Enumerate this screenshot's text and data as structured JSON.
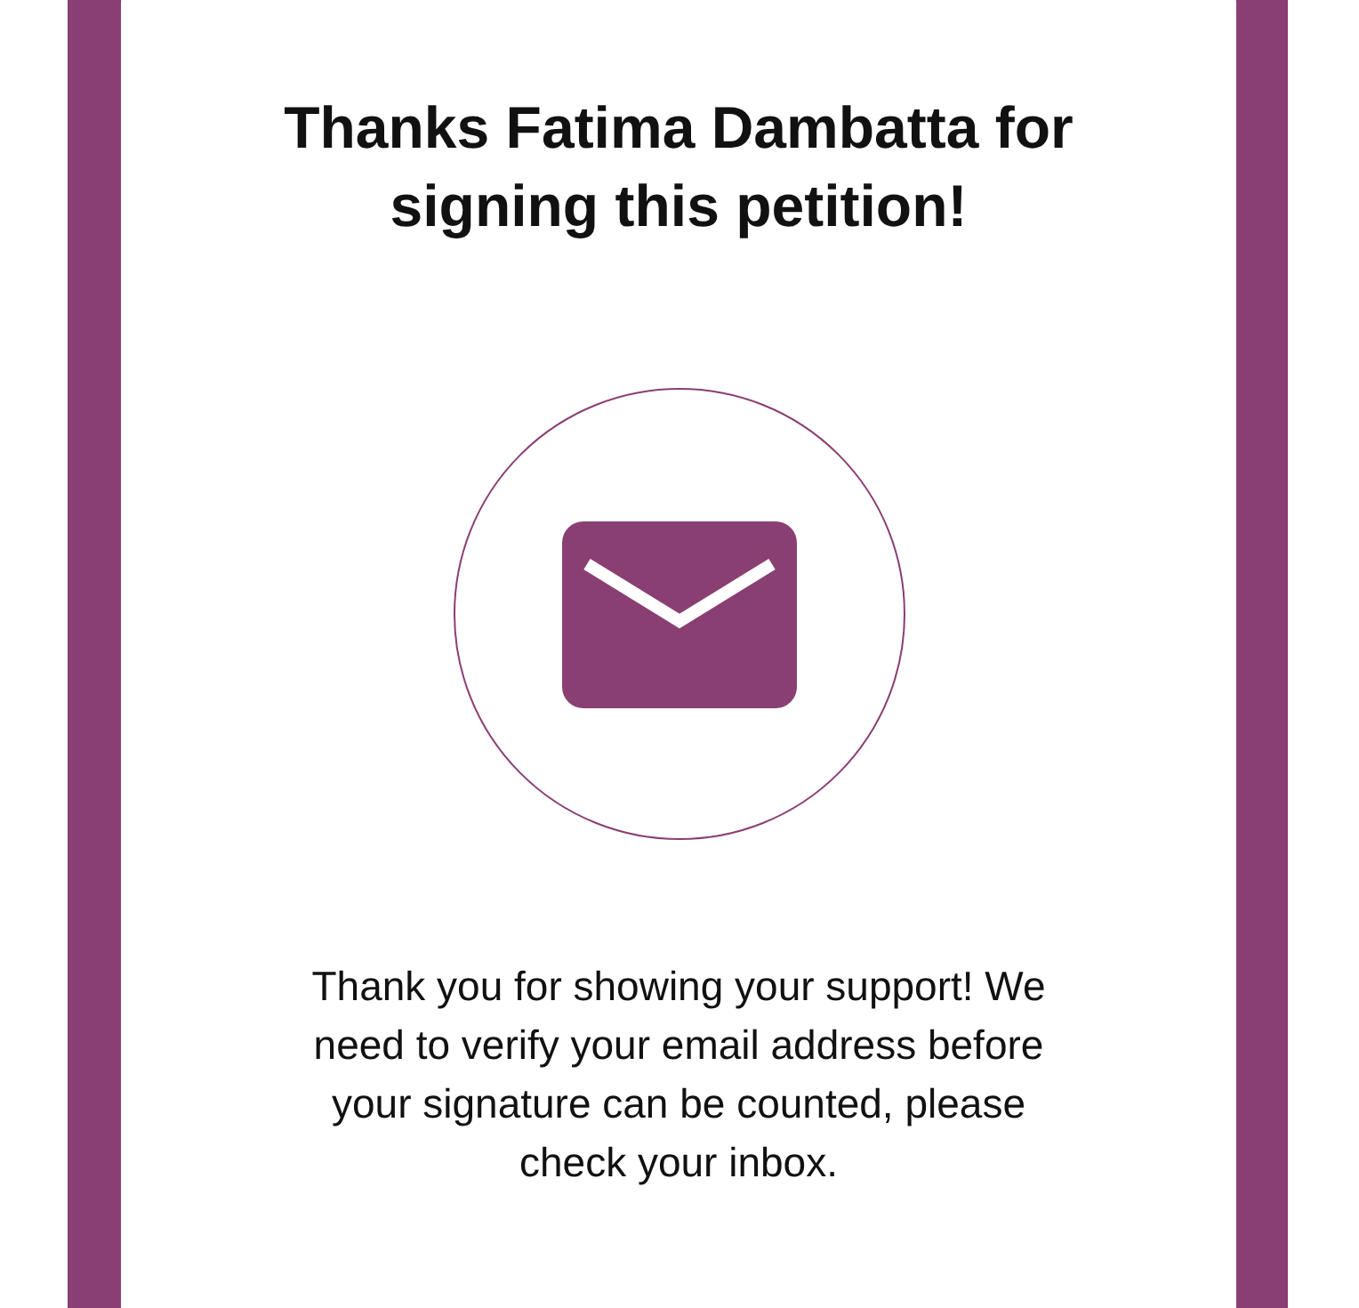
{
  "title": "Thanks Fatima Dambatta for signing this petition!",
  "message": "Thank you for showing your support! We need to verify your email address before your signature can be counted, please check your inbox."
}
